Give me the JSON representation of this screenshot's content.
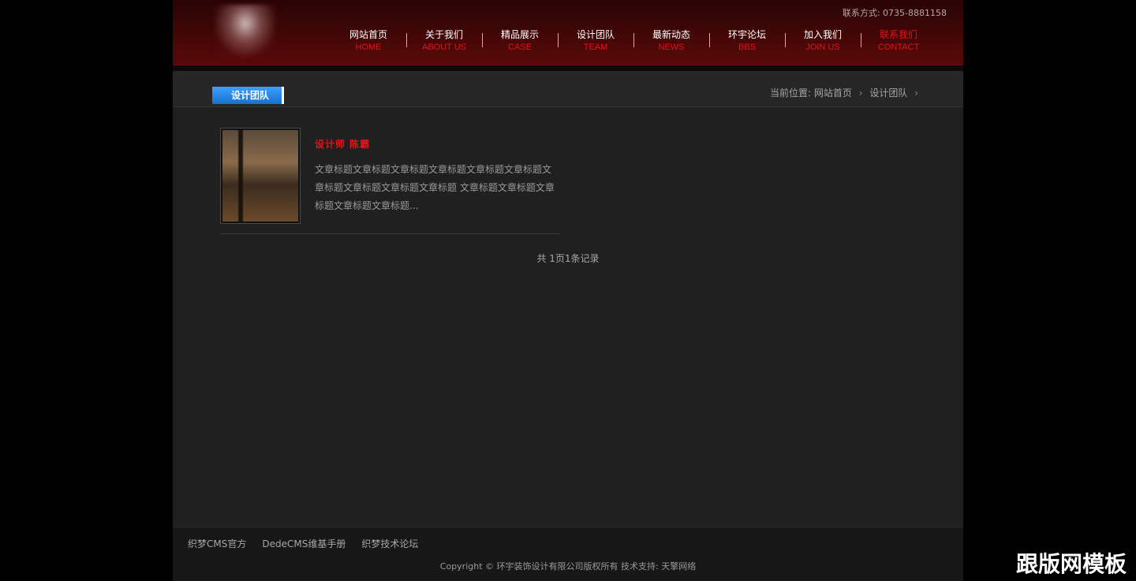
{
  "header": {
    "contact": "联系方式: 0735-8881158",
    "nav": [
      {
        "cn": "网站首页",
        "en": "HOME"
      },
      {
        "cn": "关于我们",
        "en": "ABOUT US"
      },
      {
        "cn": "精品展示",
        "en": "CASE"
      },
      {
        "cn": "设计团队",
        "en": "TEAM"
      },
      {
        "cn": "最新动态",
        "en": "NEWS"
      },
      {
        "cn": "环宇论坛",
        "en": "BBS"
      },
      {
        "cn": "加入我们",
        "en": "JOIN US"
      },
      {
        "cn": "联系我们",
        "en": "CONTACT"
      }
    ]
  },
  "section": {
    "tab_label": "设计团队",
    "breadcrumb": {
      "prefix": "当前位置:",
      "items": [
        "网站首页",
        "设计团队"
      ]
    }
  },
  "list": {
    "items": [
      {
        "title": "设计师 陈霸",
        "description": "文章标题文章标题文章标题文章标题文章标题文章标题文章标题文章标题文章标题文章标题 文章标题文章标题文章标题文章标题文章标题..."
      }
    ],
    "pager": "共 1页1条记录"
  },
  "footer": {
    "links": [
      "织梦CMS官方",
      "DedeCMS维基手册",
      "织梦技术论坛"
    ],
    "copyright": "Copyright © 环宇装饰设计有限公司版权所有   技术支持: 天擎网络"
  },
  "watermark": "跟版网模板",
  "colors": {
    "accent_red": "#e1141a",
    "tab_blue": "#1a6fd0",
    "header_bg": "#4a0707"
  }
}
